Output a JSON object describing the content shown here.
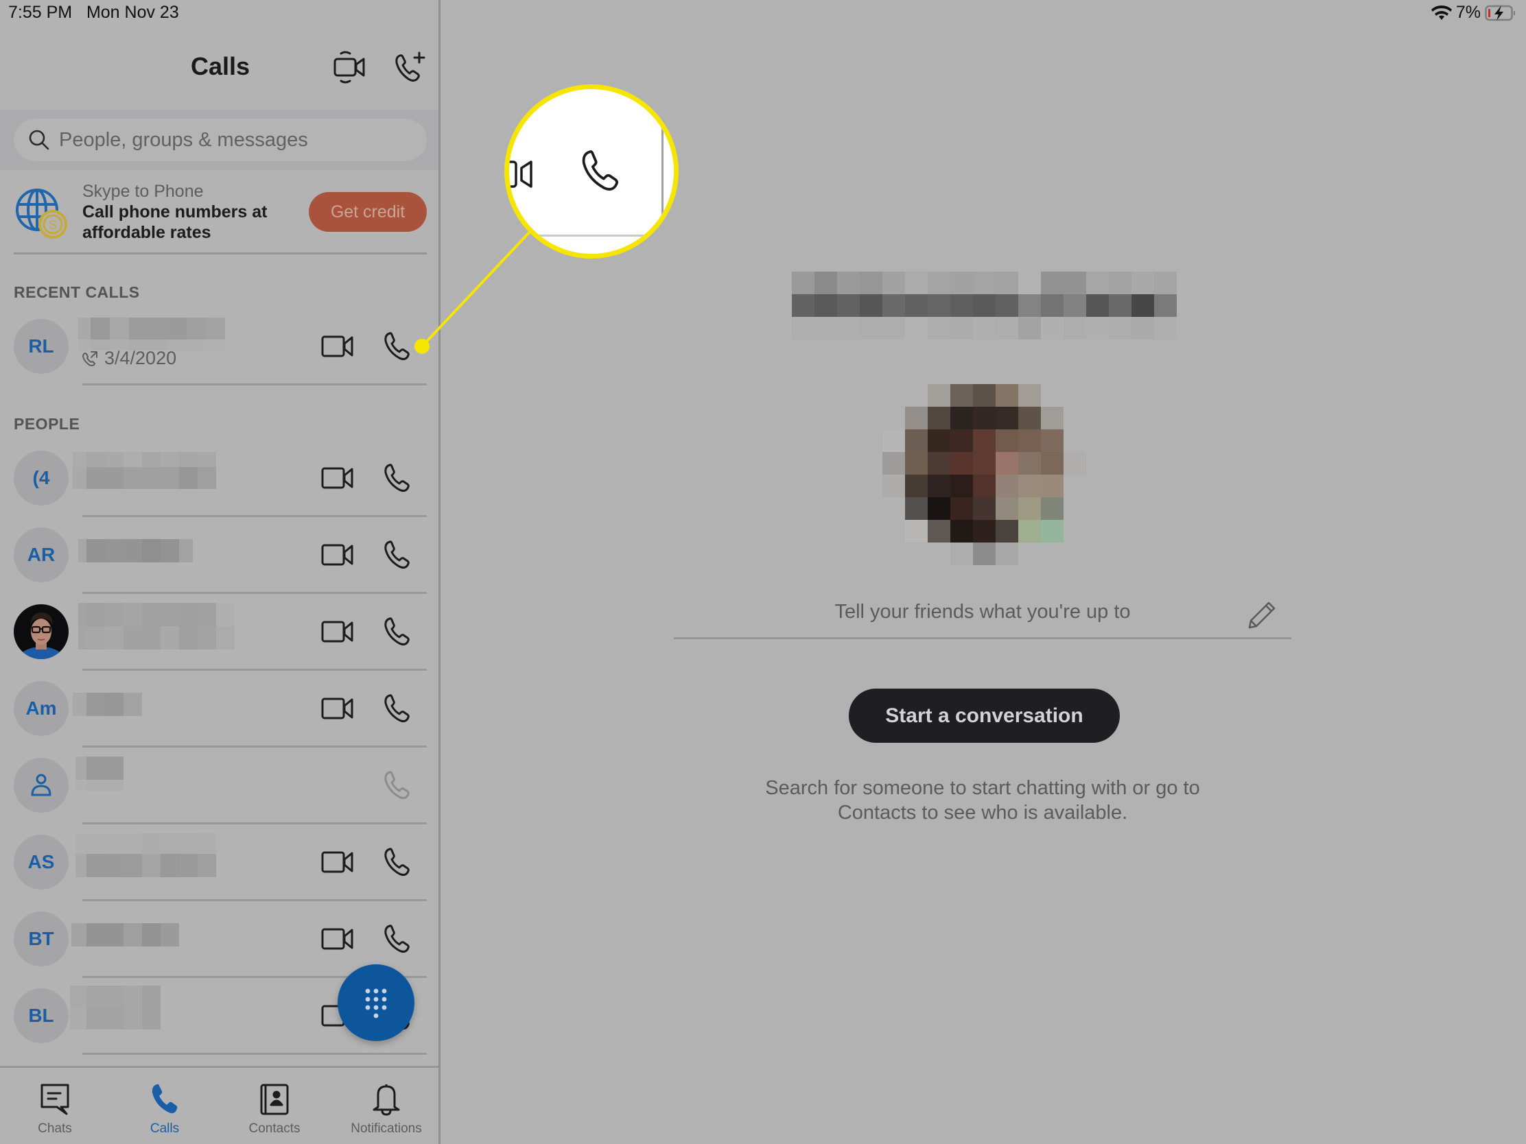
{
  "status_bar": {
    "time": "7:55 PM",
    "date": "Mon Nov 23",
    "battery": "7%",
    "wifi_icon": "wifi-icon",
    "battery_icon": "battery-charging-icon"
  },
  "header": {
    "title": "Calls",
    "meet_now_icon": "video-meet-icon",
    "new_call_icon": "phone-plus-icon"
  },
  "search": {
    "placeholder": "People, groups & messages",
    "value": ""
  },
  "promo": {
    "subtitle": "Skype to Phone",
    "title": "Call phone numbers at affordable rates",
    "button": "Get credit",
    "button_color": "#a9533d"
  },
  "recent_calls": {
    "label": "RECENT CALLS",
    "items": [
      {
        "initials": "RL",
        "name": "[redacted]",
        "date": "3/4/2020",
        "has_video": true
      }
    ]
  },
  "people": {
    "label": "PEOPLE",
    "items": [
      {
        "initials": "(4",
        "name": "[redacted]",
        "has_video": true
      },
      {
        "initials": "AR",
        "name": "[redacted]",
        "has_video": true
      },
      {
        "initials": "",
        "photo": true,
        "name": "[redacted]",
        "has_video": true
      },
      {
        "initials": "Am",
        "name": "[redacted]",
        "has_video": true
      },
      {
        "initials": "",
        "placeholder_icon": "person-icon",
        "name": "[redacted]",
        "has_video": false
      },
      {
        "initials": "AS",
        "name": "[redacted]",
        "has_video": true
      },
      {
        "initials": "BT",
        "name": "[redacted]",
        "has_video": true
      },
      {
        "initials": "BL",
        "name": "[redacted]",
        "has_video": true
      }
    ]
  },
  "dialpad_button": {
    "icon": "dialpad-icon"
  },
  "tabs": [
    {
      "label": "Chats",
      "icon": "chat-icon",
      "active": false
    },
    {
      "label": "Calls",
      "icon": "phone-icon",
      "active": true
    },
    {
      "label": "Contacts",
      "icon": "contacts-book-icon",
      "active": false
    },
    {
      "label": "Notifications",
      "icon": "bell-icon",
      "active": false
    }
  ],
  "profile": {
    "name": "[redacted]",
    "mood_placeholder": "Tell your friends what you're up to",
    "start_button": "Start a conversation",
    "help_line1": "Search for someone to start chatting with or go to",
    "help_line2": "Contacts to see who is available."
  },
  "annotation": {
    "color": "#f6e500",
    "target": "recent-call-phone-button"
  },
  "colors": {
    "accent_blue": "#1a5ea6",
    "fab_blue": "#0e569c",
    "background": "#b2b2b2"
  }
}
